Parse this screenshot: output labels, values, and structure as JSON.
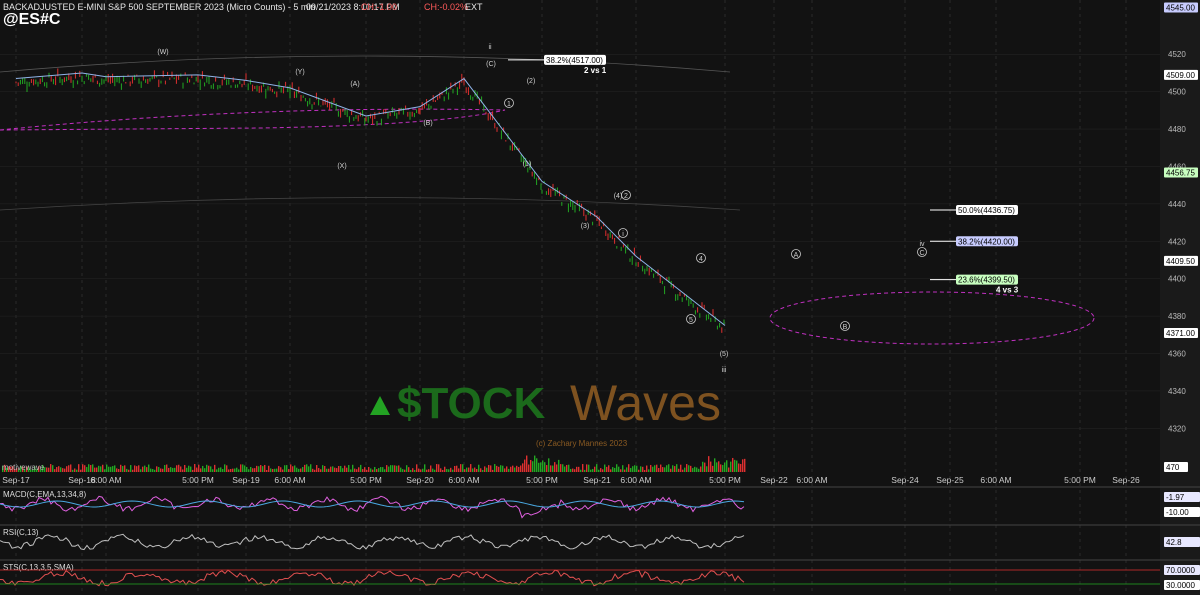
{
  "header": {
    "title": "BACKADJUSTED E-MINI S&P 500 SEPTEMBER 2023 (Micro Counts) - 5 min",
    "datetime": "09/21/2023 8:10:17 PM",
    "change": "CH:-1.00",
    "change_pct": "CH:-0.02%",
    "session": "EXT",
    "symbol": "@ES#C"
  },
  "watermark": {
    "brand_left": "$TOCK",
    "brand_right": "Waves",
    "copyright": "(c) Zachary Mannes 2023"
  },
  "colors": {
    "background": "#121212",
    "grid": "#3a3a3a",
    "up_candle": "#22a822",
    "down_candle": "#e03030",
    "ma_blue": "#8fb4e8",
    "channel_magenta": "#c030c0",
    "macd_magenta": "#e060e0",
    "macd_blue": "#4aa8e0",
    "label_green": "#c8ffc0",
    "label_blue": "#c8ccff"
  },
  "chart_data": [
    {
      "type": "line",
      "subtype": "candlestick",
      "title": "BACKADJUSTED E-MINI S&P 500 SEPTEMBER 2023 (Micro Counts) - 5 min",
      "ylim": [
        4302,
        4549
      ],
      "y_ticks": [
        4320,
        4340,
        4360,
        4380,
        4400,
        4420,
        4440,
        4460,
        4480,
        4500,
        4520
      ],
      "x_tick_labels": [
        "Sep-17",
        "Sep-18",
        "6:00 AM",
        "5:00 PM",
        "Sep-19",
        "6:00 AM",
        "5:00 PM",
        "Sep-20",
        "6:00 AM",
        "5:00 PM",
        "Sep-21",
        "6:00 AM",
        "5:00 PM",
        "Sep-22",
        "6:00 AM",
        "Sep-24",
        "Sep-25",
        "6:00 AM",
        "5:00 PM",
        "Sep-26"
      ],
      "price_path": {
        "x": [
          "Sep-17",
          "Sep-18",
          "6:00 AM",
          "5:00 PM",
          "Sep-19",
          "6:00 AM",
          "5:00 PM",
          "Sep-20",
          "6:00 AM",
          "5:00 PM",
          "Sep-21",
          "6:00 AM",
          "5:00 PM"
        ],
        "y": [
          4505,
          4508,
          4506,
          4507,
          4504,
          4500,
          4485,
          4490,
          4505,
          4450,
          4431,
          4410,
          4373
        ]
      },
      "axis_tags": [
        {
          "label": "4545.00",
          "value": 4545
        },
        {
          "label": "4509.00",
          "value": 4509
        },
        {
          "label": "4456.75",
          "value": 4456.75
        },
        {
          "label": "4409.50",
          "value": 4409.5
        },
        {
          "label": "4371.00",
          "value": 4371
        }
      ],
      "fib_levels": [
        {
          "label": "38.2%(4517.00)",
          "value": 4517,
          "note": "2 vs 1"
        },
        {
          "label": "50.0%(4436.75)",
          "value": 4436.75,
          "note": ""
        },
        {
          "label": "38.2%(4420.00)",
          "value": 4420,
          "note": ""
        },
        {
          "label": "23.6%(4399.50)",
          "value": 4399.5,
          "note": "4 vs 3"
        }
      ],
      "wave_labels": [
        "ii",
        "(C)",
        "(W)",
        "(X)",
        "(Y)",
        "(A)",
        "(B)",
        "(4)",
        "(3)",
        "(5)",
        "(1)",
        "(2)",
        "i",
        "iv",
        "iii",
        "1",
        "2",
        "4",
        "5",
        "A",
        "B",
        "C"
      ],
      "volume": {
        "label": "470"
      },
      "credit": "motivewave"
    },
    {
      "type": "line",
      "title": "MACD(C,EMA,13,34,8)",
      "value_tags": [
        {
          "label": "-1.97",
          "value": -1.97
        },
        {
          "label": "-10.00",
          "value": -10
        }
      ]
    },
    {
      "type": "line",
      "title": "RSI(C,13)",
      "value_tags": [
        {
          "label": "42.8",
          "value": 42.8
        }
      ]
    },
    {
      "type": "line",
      "title": "STS(C,13,3,5,SMA)",
      "value_tags": [
        {
          "label": "70.0000",
          "value": 70
        },
        {
          "label": "30.0000",
          "value": 30
        }
      ]
    }
  ]
}
